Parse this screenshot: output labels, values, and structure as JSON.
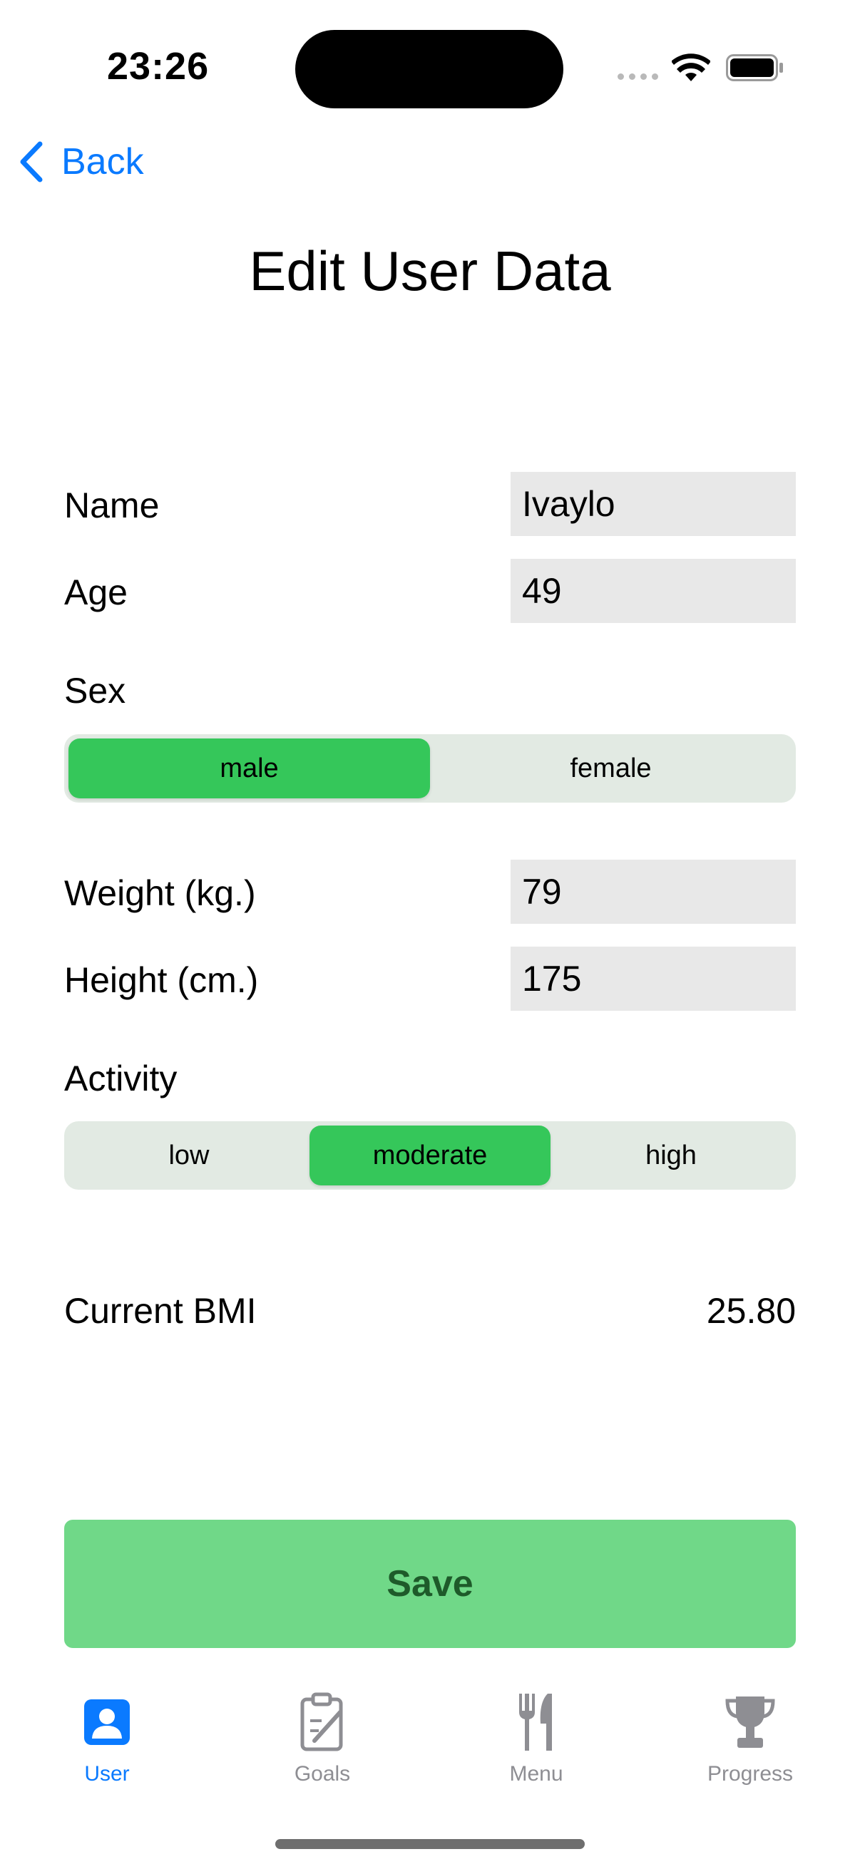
{
  "status_bar": {
    "time": "23:26"
  },
  "nav": {
    "back_label": "Back",
    "title": "Edit User Data"
  },
  "form": {
    "name": {
      "label": "Name",
      "value": "Ivaylo"
    },
    "age": {
      "label": "Age",
      "value": "49"
    },
    "sex": {
      "label": "Sex",
      "options": [
        "male",
        "female"
      ],
      "selected": "male"
    },
    "weight": {
      "label": "Weight (kg.)",
      "value": "79"
    },
    "height": {
      "label": "Height (cm.)",
      "value": "175"
    },
    "activity": {
      "label": "Activity",
      "options": [
        "low",
        "moderate",
        "high"
      ],
      "selected": "moderate"
    },
    "bmi": {
      "label": "Current BMI",
      "value": "25.80"
    }
  },
  "save_label": "Save",
  "tabs": [
    {
      "label": "User",
      "icon": "person-icon",
      "active": true
    },
    {
      "label": "Goals",
      "icon": "clipboard-icon",
      "active": false
    },
    {
      "label": "Menu",
      "icon": "fork-knife-icon",
      "active": false
    },
    {
      "label": "Progress",
      "icon": "trophy-icon",
      "active": false
    }
  ],
  "colors": {
    "accent_blue": "#0a7aff",
    "segment_selected": "#35c75a",
    "segment_bg": "#e2eae3",
    "save_button": "#70d888",
    "input_bg": "#e8e8e8"
  }
}
